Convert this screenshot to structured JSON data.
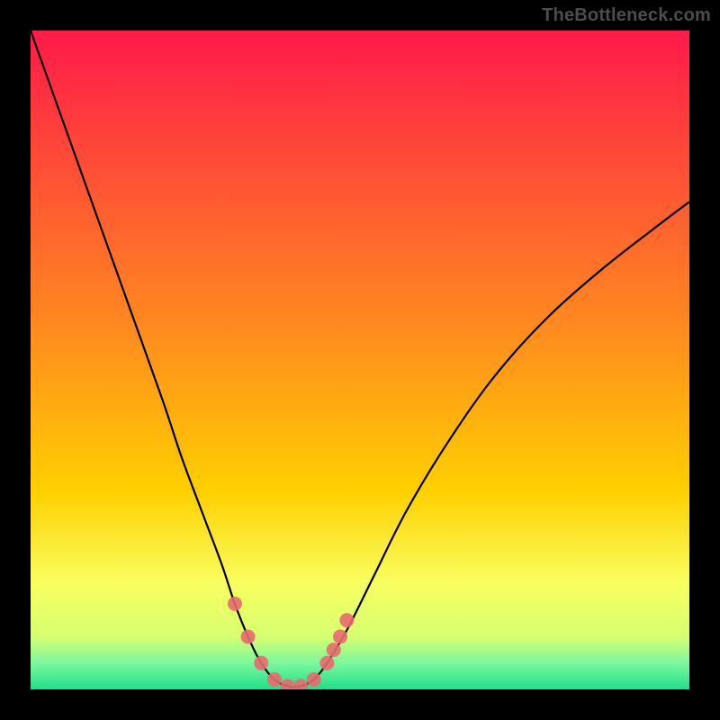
{
  "watermark": "TheBottleneck.com",
  "colors": {
    "background": "#000000",
    "grad_top": "#ff1a4a",
    "grad_mid": "#ffd000",
    "grad_low1": "#f8ff60",
    "grad_low2": "#7cf79d",
    "grad_bottom": "#1ee089",
    "curve": "#000000",
    "marker": "#e86a6f"
  },
  "chart_data": {
    "type": "line",
    "title": "",
    "xlabel": "",
    "ylabel": "",
    "xlim": [
      0,
      100
    ],
    "ylim": [
      0,
      100
    ],
    "grid": false,
    "series": [
      {
        "name": "bottleneck-curve",
        "x": [
          0,
          5,
          10,
          15,
          20,
          23,
          26,
          29,
          31,
          33,
          35,
          37,
          39,
          41,
          43,
          45,
          48,
          52,
          57,
          63,
          70,
          78,
          87,
          96,
          100
        ],
        "y": [
          100,
          86,
          72,
          58,
          44,
          35,
          27,
          19,
          13,
          8,
          4,
          1.5,
          0.5,
          0.5,
          1.5,
          4,
          9,
          17,
          27,
          37,
          47,
          56,
          64,
          71,
          74
        ]
      }
    ],
    "markers": {
      "name": "highlight-points",
      "x": [
        31,
        33,
        35,
        37,
        39,
        41,
        43,
        45,
        46,
        47,
        48
      ],
      "y": [
        13,
        8,
        4,
        1.5,
        0.5,
        0.5,
        1.5,
        4,
        6,
        8,
        10.5
      ]
    }
  }
}
